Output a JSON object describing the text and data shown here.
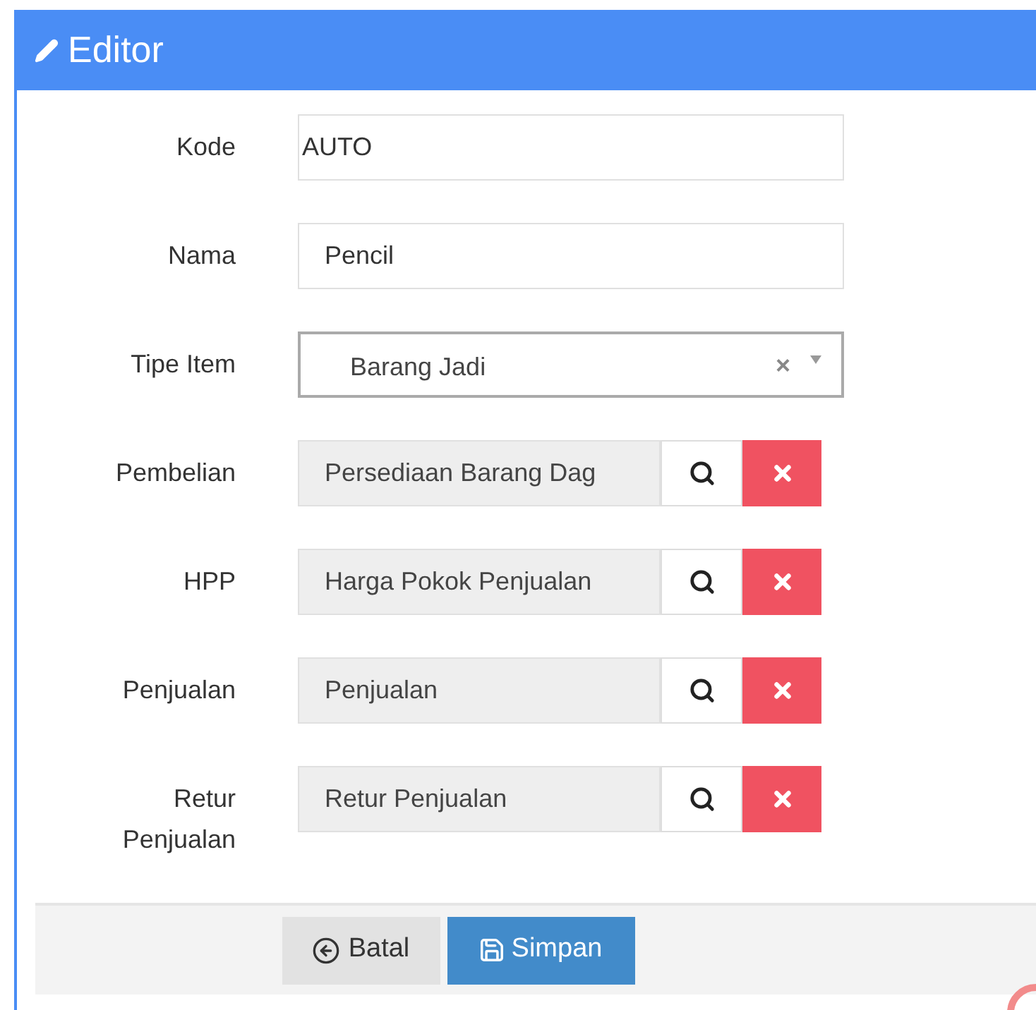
{
  "panel": {
    "title": "Editor"
  },
  "fields": [
    {
      "kind": "text",
      "label": "Kode",
      "value": "AUTO"
    },
    {
      "kind": "text",
      "label": "Nama",
      "value": "Pencil"
    },
    {
      "kind": "select",
      "label": "Tipe Item",
      "value": "Barang Jadi",
      "clear": "×"
    },
    {
      "kind": "lookup",
      "label": "Pembelian",
      "value": "Persediaan Barang Dag"
    },
    {
      "kind": "lookup",
      "label": "HPP",
      "value": "Harga Pokok Penjualan"
    },
    {
      "kind": "lookup",
      "label": "Penjualan",
      "value": "Penjualan"
    },
    {
      "kind": "lookup",
      "label": "Retur Penjualan",
      "value": "Retur Penjualan"
    }
  ],
  "buttons": [
    {
      "kind": "cancel",
      "label": "Batal"
    },
    {
      "kind": "save",
      "label": "Simpan"
    }
  ]
}
